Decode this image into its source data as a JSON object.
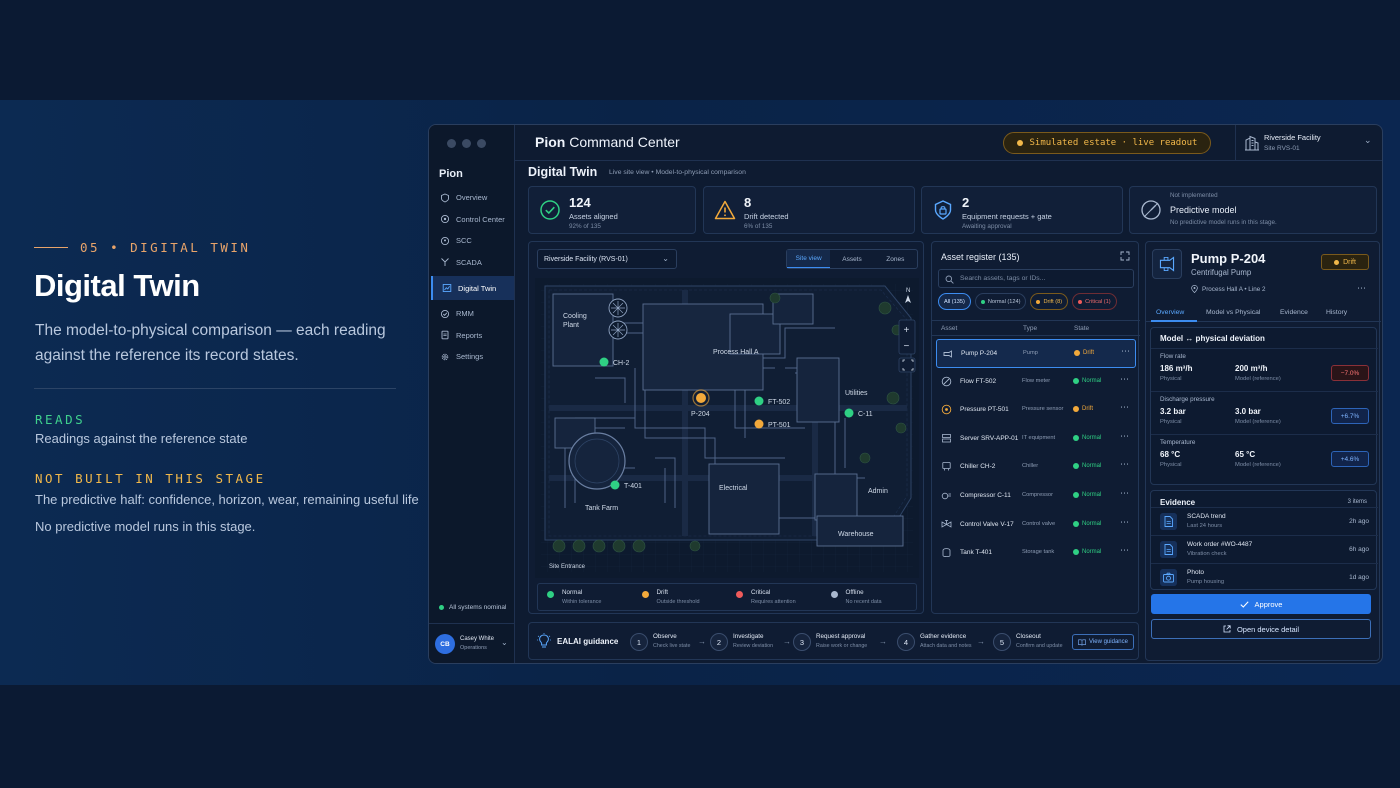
{
  "slide": {
    "eyebrow": "05 • DIGITAL TWIN",
    "title": "Digital Twin",
    "subtitle": "The model-to-physical comparison — each reading against the reference its record states.",
    "reads_key": "READS",
    "reads_value": "Readings against the reference state",
    "notbuilt_key": "NOT BUILT IN THIS STAGE",
    "notbuilt_value": "The predictive half: confidence, horizon, wear, remaining useful life",
    "notbuilt_note": "No predictive model runs in this stage."
  },
  "app": {
    "brand": "Pion",
    "title_a": "Pion",
    "title_b": "Command Center",
    "sim_badge": "Simulated estate · live readout",
    "facility_name": "Riverside Facility",
    "facility_sub": "Site RVS-01"
  },
  "nav": {
    "items": [
      {
        "label": "Overview",
        "icon": "shield-icon"
      },
      {
        "label": "Control Center",
        "icon": "control-icon"
      },
      {
        "label": "SCC",
        "icon": "location-icon"
      },
      {
        "label": "SCADA",
        "icon": "antenna-icon"
      },
      {
        "label": "Digital Twin",
        "icon": "twin-icon"
      },
      {
        "label": "RMM",
        "icon": "rmm-icon"
      },
      {
        "label": "Reports",
        "icon": "reports-icon"
      },
      {
        "label": "Settings",
        "icon": "gear-icon"
      }
    ],
    "status": "All systems nominal",
    "user_initials": "CB",
    "user_name": "Casey White",
    "user_role": "Operations"
  },
  "page": {
    "title": "Digital Twin",
    "breadcrumb": "Live site view • Model-to-physical comparison"
  },
  "kpis": [
    {
      "value": "124",
      "label": "Assets aligned",
      "sub": "92% of 135"
    },
    {
      "value": "8",
      "label": "Drift detected",
      "sub": "6% of 135"
    },
    {
      "value": "2",
      "label": "Equipment requests + gate",
      "sub": "Awaiting approval"
    },
    {
      "value": "Not implemented",
      "label": "Predictive model",
      "sub": "No predictive model runs in this stage."
    }
  ],
  "map": {
    "facility_select": "Riverside Facility (RVS-01)",
    "views": [
      "Site view",
      "Assets",
      "Zones"
    ],
    "areas": {
      "cooling": "Cooling",
      "plant": "Plant",
      "process": "Process Hall A",
      "utilities": "Utilities",
      "electrical": "Electrical",
      "admin": "Admin",
      "warehouse": "Warehouse",
      "tankfarm": "Tank Farm",
      "entrance": "Site Entrance",
      "north": "N"
    },
    "markers": {
      "ch2": "CH-2",
      "p204": "P-204",
      "ft502": "FT-502",
      "pt501": "PT-501",
      "c11": "C-11",
      "t401": "T-401"
    },
    "zoom_in": "+",
    "zoom_out": "−",
    "legend": [
      {
        "label": "Normal",
        "desc": "Within tolerance",
        "color": "#2fd084"
      },
      {
        "label": "Drift",
        "desc": "Outside threshold",
        "color": "#f2a93b"
      },
      {
        "label": "Critical",
        "desc": "Requires attention",
        "color": "#ef5b5b"
      },
      {
        "label": "Offline",
        "desc": "No recent data",
        "color": "#a9b8cf"
      }
    ]
  },
  "guidance": {
    "title": "EALAI guidance",
    "steps": [
      {
        "n": "1",
        "title": "Observe",
        "desc": "Check live state"
      },
      {
        "n": "2",
        "title": "Investigate",
        "desc": "Review deviation"
      },
      {
        "n": "3",
        "title": "Request approval",
        "desc": "Raise work or change"
      },
      {
        "n": "4",
        "title": "Gather evidence",
        "desc": "Attach data and notes"
      },
      {
        "n": "5",
        "title": "Closeout",
        "desc": "Confirm and update"
      }
    ],
    "arrow": "→",
    "view_label": "View guidance"
  },
  "register": {
    "title": "Asset register (135)",
    "search_placeholder": "Search assets, tags or IDs...",
    "chips": [
      "All (135)",
      "Normal (124)",
      "Drift (8)",
      "Critical (1)"
    ],
    "columns": [
      "Asset",
      "Type",
      "State"
    ],
    "more": "⋯",
    "rows": [
      {
        "name": "Pump P-204",
        "type": "Pump",
        "state": "Drift",
        "icon": "pump-icon"
      },
      {
        "name": "Flow FT-502",
        "type": "Flow meter",
        "state": "Normal",
        "icon": "flow-icon"
      },
      {
        "name": "Pressure PT-501",
        "type": "Pressure sensor",
        "state": "Drift",
        "icon": "pressure-icon"
      },
      {
        "name": "Server SRV-APP-01",
        "type": "IT equipment",
        "state": "Normal",
        "icon": "server-icon"
      },
      {
        "name": "Chiller CH-2",
        "type": "Chiller",
        "state": "Normal",
        "icon": "chiller-icon"
      },
      {
        "name": "Compressor C-11",
        "type": "Compressor",
        "state": "Normal",
        "icon": "compressor-icon"
      },
      {
        "name": "Control Valve V-17",
        "type": "Control valve",
        "state": "Normal",
        "icon": "valve-icon"
      },
      {
        "name": "Tank T-401",
        "type": "Storage tank",
        "state": "Normal",
        "icon": "tank-icon"
      }
    ]
  },
  "detail": {
    "title": "Pump P-204",
    "subtitle": "Centrifugal Pump",
    "location": "Process Hall A  •  Line 2",
    "badge": "Drift",
    "more": "⋯",
    "tabs": [
      "Overview",
      "Model vs Physical",
      "Evidence",
      "History"
    ],
    "deviation_title": "Model ↔ physical deviation",
    "metrics": [
      {
        "label": "Flow rate",
        "physical": "186 m³/h",
        "physical_key": "Physical",
        "model": "200 m³/h",
        "model_key": "Model (reference)",
        "delta": "−7.0%"
      },
      {
        "label": "Discharge pressure",
        "physical": "3.2 bar",
        "physical_key": "Physical",
        "model": "3.0 bar",
        "model_key": "Model (reference)",
        "delta": "+6.7%"
      },
      {
        "label": "Temperature",
        "physical": "68 °C",
        "physical_key": "Physical",
        "model": "65 °C",
        "model_key": "Model (reference)",
        "delta": "+4.6%"
      }
    ],
    "evidence_title": "Evidence",
    "evidence_count": "3 items",
    "evidence": [
      {
        "title": "SCADA trend",
        "sub": "Last 24 hours",
        "age": "2h ago"
      },
      {
        "title": "Work order #WO-4487",
        "sub": "Vibration check",
        "age": "6h ago"
      },
      {
        "title": "Photo",
        "sub": "Pump housing",
        "age": "1d ago"
      }
    ],
    "approve": "Approve",
    "open_device": "Open device detail"
  },
  "colors": {
    "normal": "#2fd084",
    "drift": "#f2a93b",
    "critical": "#ef5b5b",
    "accent": "#2575e8"
  }
}
